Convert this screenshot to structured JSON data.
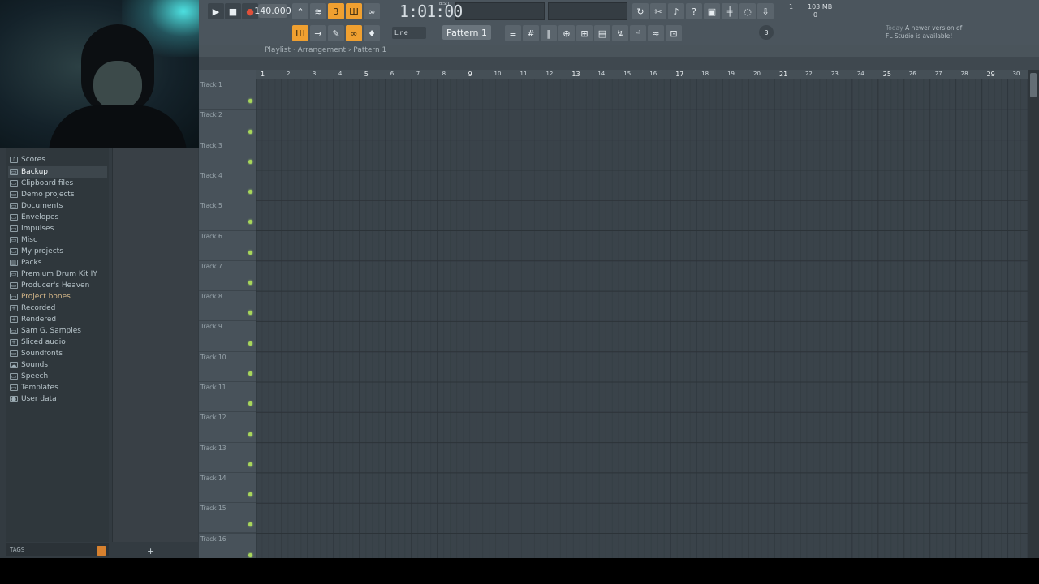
{
  "toolbar": {
    "tempo": "140.000",
    "song_time": "1:01:00",
    "song_time_sub": "B:S:T",
    "cpu_value": "1",
    "memory": "103 MB",
    "poly_value": "0",
    "snap": "Line",
    "pattern": "Pattern 1",
    "news_date": "Today",
    "news_line1": "A newer version of",
    "news_line2": "FL Studio is available!",
    "news_count": "3"
  },
  "browser": {
    "items": [
      {
        "label": "Scores",
        "icon": "note-icon"
      },
      {
        "label": "Backup",
        "icon": "folder-icon"
      },
      {
        "label": "Clipboard files",
        "icon": "folder-icon"
      },
      {
        "label": "Demo projects",
        "icon": "folder-icon"
      },
      {
        "label": "Documents",
        "icon": "folder-icon"
      },
      {
        "label": "Envelopes",
        "icon": "folder-icon"
      },
      {
        "label": "Impulses",
        "icon": "folder-icon"
      },
      {
        "label": "Misc",
        "icon": "folder-icon"
      },
      {
        "label": "My projects",
        "icon": "folder-icon"
      },
      {
        "label": "Packs",
        "icon": "packs-icon"
      },
      {
        "label": "Premium Drum Kit IY",
        "icon": "folder-icon"
      },
      {
        "label": "Producer's Heaven",
        "icon": "folder-icon"
      },
      {
        "label": "Project bones",
        "icon": "folder-icon"
      },
      {
        "label": "Recorded",
        "icon": "plus-icon"
      },
      {
        "label": "Rendered",
        "icon": "plus-icon"
      },
      {
        "label": "Sam G. Samples",
        "icon": "folder-icon"
      },
      {
        "label": "Sliced audio",
        "icon": "plus-icon"
      },
      {
        "label": "Soundfonts",
        "icon": "folder-icon"
      },
      {
        "label": "Sounds",
        "icon": "cloud-icon"
      },
      {
        "label": "Speech",
        "icon": "folder-icon"
      },
      {
        "label": "Templates",
        "icon": "folder-icon"
      },
      {
        "label": "User data",
        "icon": "user-icon"
      }
    ],
    "tags_label": "TAGS"
  },
  "playlist": {
    "title": "Playlist · Arrangement › Pattern 1",
    "ruler": [
      "1",
      "2",
      "3",
      "4",
      "5",
      "6",
      "7",
      "8",
      "9",
      "10",
      "11",
      "12",
      "13",
      "14",
      "15",
      "16",
      "17",
      "18",
      "19",
      "20",
      "21",
      "22",
      "23",
      "24",
      "25",
      "26",
      "27",
      "28",
      "29",
      "30"
    ],
    "tracks": [
      "Track 1",
      "Track 2",
      "Track 3",
      "Track 4",
      "Track 5",
      "Track 6",
      "Track 7",
      "Track 8",
      "Track 9",
      "Track 10",
      "Track 11",
      "Track 12",
      "Track 13",
      "Track 14",
      "Track 15",
      "Track 16"
    ]
  },
  "colors": {
    "accent": "#f0a030",
    "led": "#a9d65a"
  }
}
